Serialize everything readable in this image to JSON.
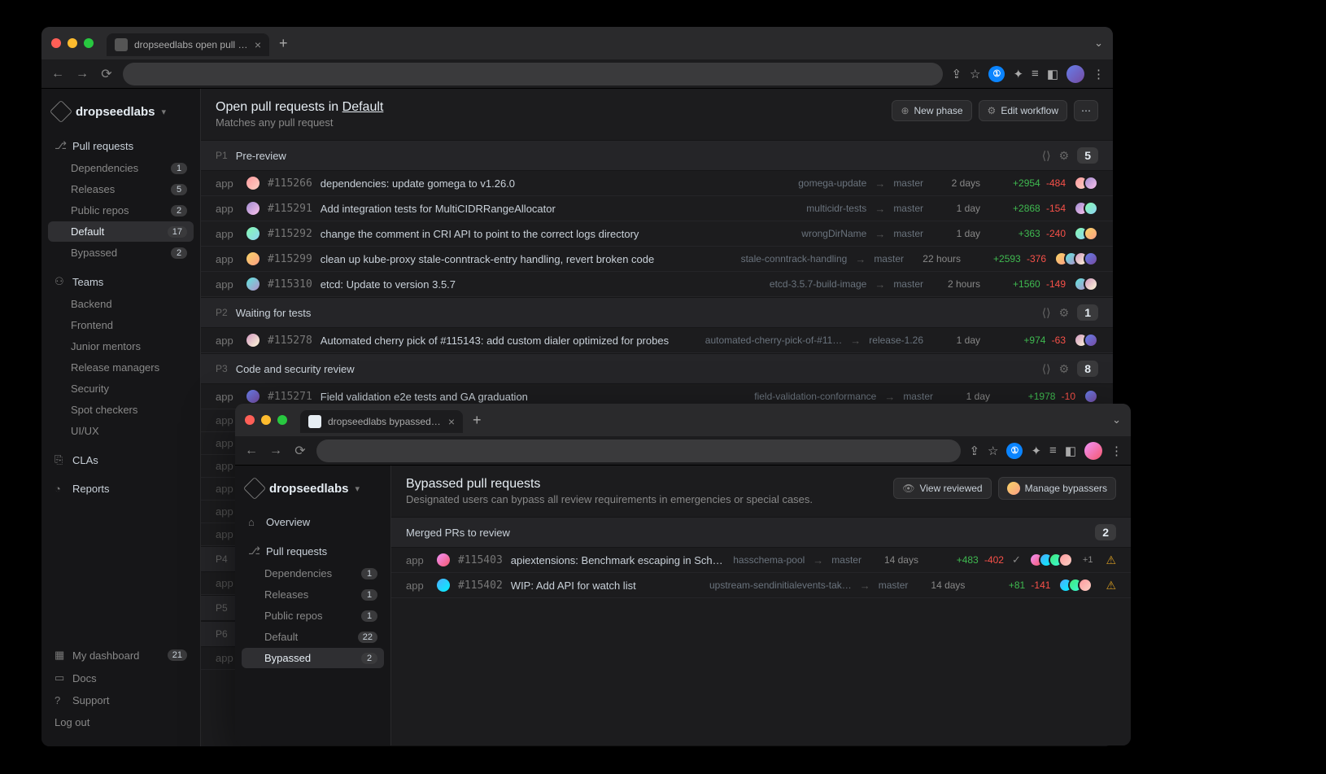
{
  "window1": {
    "tab_title": "dropseedlabs open pull reques",
    "workspace": "dropseedlabs",
    "header": {
      "title_prefix": "Open pull requests in ",
      "title_link": "Default",
      "subtitle": "Matches any pull request",
      "new_phase": "New phase",
      "edit_workflow": "Edit workflow"
    },
    "sidebar": {
      "pull_requests": "Pull requests",
      "teams": "Teams",
      "clas": "CLAs",
      "reports": "Reports",
      "my_dashboard": "My dashboard",
      "my_dashboard_count": "21",
      "docs": "Docs",
      "support": "Support",
      "logout": "Log out",
      "pr_items": [
        {
          "label": "Dependencies",
          "count": "1"
        },
        {
          "label": "Releases",
          "count": "5"
        },
        {
          "label": "Public repos",
          "count": "2"
        },
        {
          "label": "Default",
          "count": "17",
          "active": true
        },
        {
          "label": "Bypassed",
          "count": "2"
        }
      ],
      "team_items": [
        {
          "label": "Backend"
        },
        {
          "label": "Frontend"
        },
        {
          "label": "Junior mentors"
        },
        {
          "label": "Release managers"
        },
        {
          "label": "Security"
        },
        {
          "label": "Spot checkers"
        },
        {
          "label": "UI/UX"
        }
      ]
    },
    "phases": [
      {
        "tag": "P1",
        "name": "Pre-review",
        "count": "5",
        "prs": [
          {
            "repo": "app",
            "num": "#115266",
            "title": "dependencies: update gomega to v1.26.0",
            "branch": "gomega-update",
            "target": "master",
            "age": "2 days",
            "add": "+2954",
            "del": "-484",
            "avs": 2,
            "g": 1
          },
          {
            "repo": "app",
            "num": "#115291",
            "title": "Add integration tests for MultiCIDRRangeAllocator",
            "branch": "multicidr-tests",
            "target": "master",
            "age": "1 day",
            "add": "+2868",
            "del": "-154",
            "avs": 2,
            "g": 2
          },
          {
            "repo": "app",
            "num": "#115292",
            "title": "change the comment in CRI API to point to the correct logs directory",
            "branch": "wrongDirName",
            "target": "master",
            "age": "1 day",
            "add": "+363",
            "del": "-240",
            "avs": 2,
            "g": 3
          },
          {
            "repo": "app",
            "num": "#115299",
            "title": "clean up kube-proxy stale-conntrack-entry handling, revert broken code",
            "branch": "stale-conntrack-handling",
            "target": "master",
            "age": "22 hours",
            "add": "+2593",
            "del": "-376",
            "avs": 4,
            "g": 4
          },
          {
            "repo": "app",
            "num": "#115310",
            "title": "etcd: Update to version 3.5.7",
            "branch": "etcd-3.5.7-build-image",
            "target": "master",
            "age": "2 hours",
            "add": "+1560",
            "del": "-149",
            "avs": 2,
            "g": 5
          }
        ]
      },
      {
        "tag": "P2",
        "name": "Waiting for tests",
        "count": "1",
        "prs": [
          {
            "repo": "app",
            "num": "#115278",
            "title": "Automated cherry pick of #115143: add custom dialer optimized for probes",
            "branch": "automated-cherry-pick-of-#11…",
            "target": "release-1.26",
            "age": "1 day",
            "add": "+974",
            "del": "-63",
            "avs": 2,
            "g": 6
          }
        ]
      },
      {
        "tag": "P3",
        "name": "Code and security review",
        "count": "8",
        "prs": [
          {
            "repo": "app",
            "num": "#115271",
            "title": "Field validation e2e tests and GA graduation",
            "branch": "field-validation-conformance",
            "target": "master",
            "age": "1 day",
            "add": "+1978",
            "del": "-10",
            "avs": 1,
            "g": 7
          }
        ],
        "stubs": 6
      },
      {
        "tag": "P4",
        "name": "",
        "count": "",
        "stubs": 1,
        "header_only": true
      },
      {
        "tag": "P5",
        "name": "",
        "count": "",
        "stubs": 0,
        "header_only": true
      },
      {
        "tag": "P6",
        "name": "",
        "count": "",
        "stubs": 1,
        "header_only": true
      }
    ]
  },
  "window2": {
    "tab_title": "dropseedlabs bypassed pull re",
    "workspace": "dropseedlabs",
    "header": {
      "title": "Bypassed pull requests",
      "subtitle": "Designated users can bypass all review requirements in emergencies or special cases.",
      "view_reviewed": "View reviewed",
      "manage_bypassers": "Manage bypassers"
    },
    "sidebar": {
      "overview": "Overview",
      "pull_requests": "Pull requests",
      "pr_items": [
        {
          "label": "Dependencies",
          "count": "1"
        },
        {
          "label": "Releases",
          "count": "1"
        },
        {
          "label": "Public repos",
          "count": "1"
        },
        {
          "label": "Default",
          "count": "22"
        },
        {
          "label": "Bypassed",
          "count": "2",
          "active": true
        }
      ]
    },
    "section": {
      "title": "Merged PRs to review",
      "count": "2",
      "prs": [
        {
          "repo": "app",
          "num": "#115403",
          "title": "apiextensions: Benchmark escaping in Sche…",
          "branch": "hasschema-pool",
          "target": "master",
          "age": "14 days",
          "add": "+483",
          "del": "-402",
          "avs": 4,
          "plus": "+1",
          "warn": true,
          "g": 8,
          "check": true
        },
        {
          "repo": "app",
          "num": "#115402",
          "title": "WIP: Add API for watch list",
          "branch": "upstream-sendinitialevents-tak…",
          "target": "master",
          "age": "14 days",
          "add": "+81",
          "del": "-141",
          "avs": 3,
          "warn": true,
          "g": 9
        }
      ]
    }
  }
}
